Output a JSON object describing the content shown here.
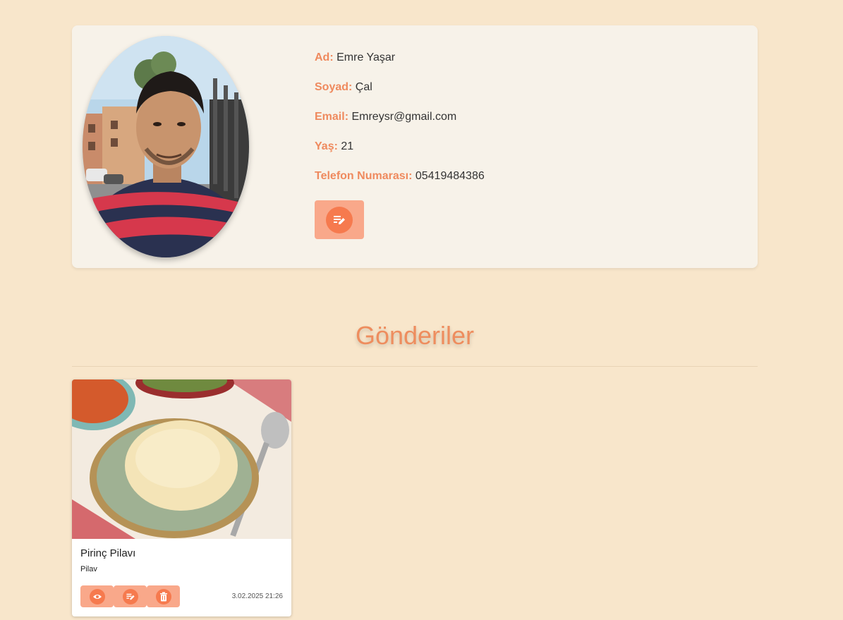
{
  "profile": {
    "fields": [
      {
        "label": "Ad:",
        "value": "Emre Yaşar"
      },
      {
        "label": "Soyad:",
        "value": "Çal"
      },
      {
        "label": "Email:",
        "value": "Emreysr@gmail.com"
      },
      {
        "label": "Yaş:",
        "value": "21"
      },
      {
        "label": "Telefon Numarası:",
        "value": "05419484386"
      }
    ],
    "edit_icon": "edit-note-icon"
  },
  "posts_section": {
    "title": "Gönderiler",
    "posts": [
      {
        "title": "Pirinç Pilavı",
        "category": "Pilav",
        "date": "3.02.2025 21:26",
        "actions": [
          "eye-icon",
          "edit-note-icon",
          "trash-icon"
        ]
      }
    ]
  },
  "colors": {
    "background": "#f8e6cb",
    "card": "#f7f2e9",
    "accent": "#ef8a5e",
    "button": "#f9a88a",
    "button_icon": "#f67a4e"
  }
}
